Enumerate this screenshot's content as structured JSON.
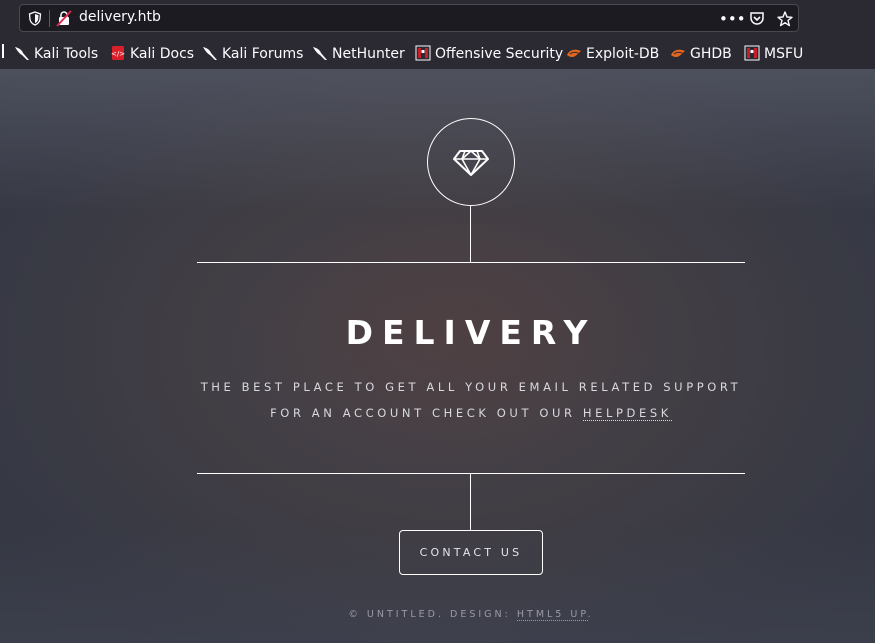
{
  "browser": {
    "url": "delivery.htb",
    "bookmarks": [
      {
        "label": "Kali Tools",
        "icon": "kali-dragon-icon"
      },
      {
        "label": "Kali Docs",
        "icon": "kali-docs-icon"
      },
      {
        "label": "Kali Forums",
        "icon": "kali-dragon-icon"
      },
      {
        "label": "NetHunter",
        "icon": "kali-dragon-icon"
      },
      {
        "label": "Offensive Security",
        "icon": "offsec-icon"
      },
      {
        "label": "Exploit-DB",
        "icon": "exploitdb-icon"
      },
      {
        "label": "GHDB",
        "icon": "exploitdb-icon"
      },
      {
        "label": "MSFU",
        "icon": "offsec-icon"
      }
    ]
  },
  "hero": {
    "title": "DELIVERY",
    "tagline_line1": "THE BEST PLACE TO GET ALL YOUR EMAIL RELATED SUPPORT",
    "tagline_line2_prefix": "FOR AN ACCOUNT CHECK OUT OUR",
    "helpdesk_link": "HELPDESK",
    "contact_button": "CONTACT US",
    "logo_icon": "diamond-icon"
  },
  "footer": {
    "copyright": "© UNTITLED. DESIGN:",
    "design_link": "HTML5 UP",
    "trailing": "."
  }
}
